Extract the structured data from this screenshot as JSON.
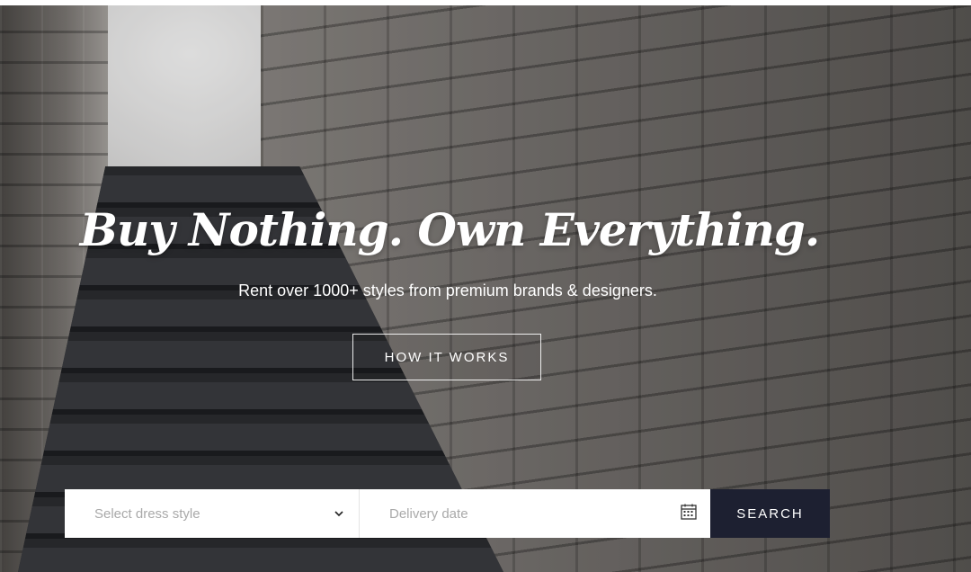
{
  "hero": {
    "headline": "Buy Nothing. Own Everything.",
    "subheadline": "Rent over 1000+ styles from premium brands & designers.",
    "cta_label": "HOW IT WORKS"
  },
  "search": {
    "style_placeholder": "Select dress style",
    "date_placeholder": "Delivery date",
    "button_label": "SEARCH"
  },
  "icons": {
    "select_chevron": "chevron-down-icon",
    "date": "calendar-icon"
  },
  "colors": {
    "search_button": "#1d2031",
    "dress": "#8d1329"
  }
}
